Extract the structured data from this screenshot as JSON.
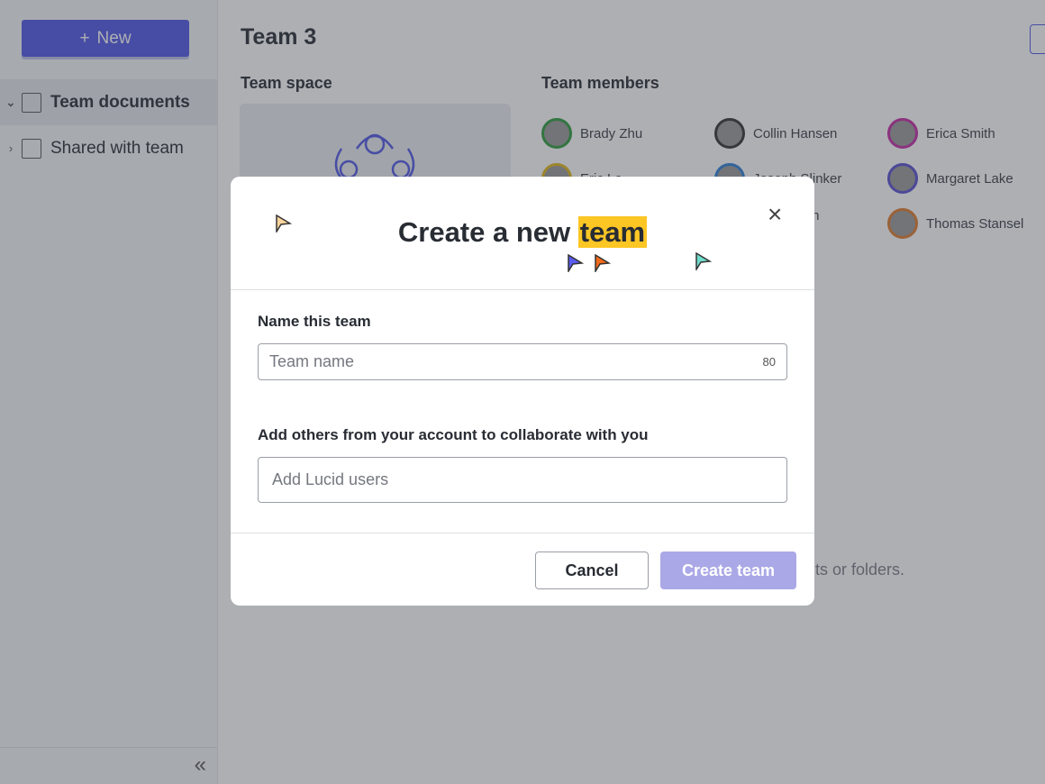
{
  "sidebar": {
    "new_label": "New",
    "items": [
      {
        "label": "Team documents",
        "icon": "documents-icon",
        "active": true
      },
      {
        "label": "Shared with team",
        "icon": "shared-folder-icon",
        "active": false
      }
    ],
    "collapse_icon": "double-chevron-left-icon"
  },
  "main": {
    "title": "Team 3",
    "team_space_heading": "Team space",
    "members_heading": "Team members",
    "members": [
      {
        "name": "Brady Zhu",
        "color": "#2e9b3c"
      },
      {
        "name": "Collin Hansen",
        "color": "#333333"
      },
      {
        "name": "Erica Smith",
        "color": "#c42aa4"
      },
      {
        "name": "Eric Le",
        "color": "#e2b71a"
      },
      {
        "name": "Joseph Slinker",
        "color": "#2d7fd6"
      },
      {
        "name": "Margaret Lake",
        "color": "#5a4ed0"
      },
      {
        "name": "arson",
        "color": "#888888"
      },
      {
        "name": "Thomas Stansel",
        "color": "#e07b2c"
      }
    ],
    "empty_text": "ts or folders."
  },
  "modal": {
    "title_prefix": "Create a new ",
    "title_highlight": "team",
    "name_label": "Name this team",
    "name_placeholder": "Team name",
    "name_limit": "80",
    "add_label": "Add others from your account to collaborate with you",
    "add_placeholder": "Add Lucid users",
    "cancel_label": "Cancel",
    "create_label": "Create team",
    "cursor_colors": [
      "#f9d49c",
      "#5a5cf0",
      "#f26a1b",
      "#6fdccc"
    ],
    "highlight_color": "#fcc624"
  }
}
